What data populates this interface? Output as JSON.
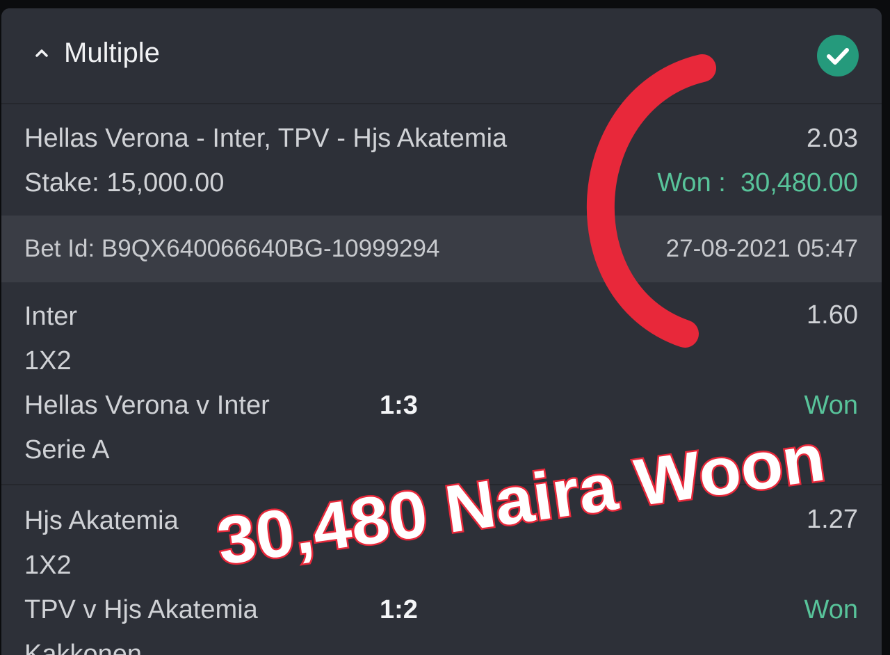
{
  "header": {
    "title": "Multiple"
  },
  "summary": {
    "events": "Hellas Verona - Inter, TPV - Hjs Akatemia",
    "odds": "2.03",
    "stake_label": "Stake: 15,000.00",
    "won_label": "Won :",
    "won_amount": "30,480.00"
  },
  "bet": {
    "id_label": "Bet Id: B9QX640066640BG-10999294",
    "datetime": "27-08-2021 05:47"
  },
  "selections": [
    {
      "pick": "Inter",
      "odds": "1.60",
      "market": "1X2",
      "match": "Hellas Verona v Inter",
      "score": "1:3",
      "result": "Won",
      "league": "Serie A"
    },
    {
      "pick": "Hjs Akatemia",
      "odds": "1.27",
      "market": "1X2",
      "match": "TPV v Hjs Akatemia",
      "score": "1:2",
      "result": "Won",
      "league": "Kakkonen"
    }
  ],
  "overlay": {
    "caption": "30,480 Naira Woon"
  },
  "colors": {
    "card_bg": "#2d3038",
    "band_bg": "#3a3d45",
    "won_green": "#58c39a",
    "check_green": "#259a7c",
    "annotation_red": "#e8283a"
  },
  "icons": {
    "collapse": "chevron-up-icon",
    "status": "check-circle-icon"
  }
}
